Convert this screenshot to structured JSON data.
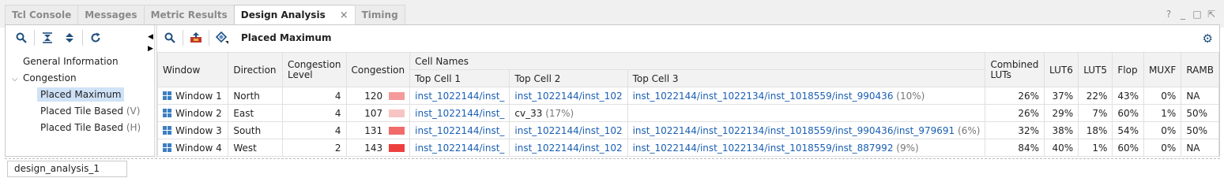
{
  "tabs": [
    {
      "label": "Tcl Console"
    },
    {
      "label": "Messages"
    },
    {
      "label": "Metric Results"
    },
    {
      "label": "Design Analysis",
      "close": "×"
    },
    {
      "label": "Timing"
    }
  ],
  "window_controls": {
    "help": "?",
    "minimize": "_",
    "restore": "□",
    "maximize": "⇱"
  },
  "left_tree": {
    "items": [
      {
        "label": "General Information",
        "sub": ""
      },
      {
        "label": "Congestion",
        "sub": ""
      },
      {
        "label": "Placed Maximum",
        "sub": ""
      },
      {
        "label": "Placed Tile Based",
        "sub": "(V)"
      },
      {
        "label": "Placed Tile Based",
        "sub": "(H)"
      }
    ]
  },
  "right_toolbar": {
    "title": "Placed Maximum"
  },
  "table": {
    "headers": {
      "window": "Window",
      "direction": "Direction",
      "congestion_level": "Congestion Level",
      "congestion": "Congestion",
      "cell_names": "Cell Names",
      "top_cell_1": "Top Cell 1",
      "top_cell_2": "Top Cell 2",
      "top_cell_3": "Top Cell 3",
      "combined_luts": "Combined LUTs",
      "lut6": "LUT6",
      "lut5": "LUT5",
      "flop": "Flop",
      "muxf": "MUXF",
      "ramb": "RAMB"
    },
    "rows": [
      {
        "window": "Window 1",
        "direction": "North",
        "level": "4",
        "congestion": "120",
        "color": "#f59a9a",
        "cell1": "inst_1022144/inst_",
        "cell2": "inst_1022144/inst_102",
        "cell2_pct": "",
        "cell3": "inst_1022144/inst_1022134/inst_1018559/inst_990436",
        "cell3_pct": "(10%)",
        "combined": "26%",
        "lut6": "37%",
        "lut5": "22%",
        "flop": "43%",
        "muxf": "0%",
        "ramb": "NA"
      },
      {
        "window": "Window 2",
        "direction": "East",
        "level": "4",
        "congestion": "107",
        "color": "#f7c4c4",
        "cell1": "inst_1022144/inst_",
        "cell2": "cv_33",
        "cell2_pct": "(17%)",
        "cell3": "",
        "cell3_pct": "",
        "combined": "26%",
        "lut6": "29%",
        "lut5": "7%",
        "flop": "60%",
        "muxf": "1%",
        "ramb": "50%"
      },
      {
        "window": "Window 3",
        "direction": "South",
        "level": "4",
        "congestion": "131",
        "color": "#f26a6a",
        "cell1": "inst_1022144/inst_",
        "cell2": "inst_1022144/inst_102",
        "cell2_pct": "",
        "cell3": "inst_1022144/inst_1022134/inst_1018559/inst_990436/inst_979691",
        "cell3_pct": "(6%)",
        "combined": "32%",
        "lut6": "38%",
        "lut5": "18%",
        "flop": "54%",
        "muxf": "0%",
        "ramb": "50%"
      },
      {
        "window": "Window 4",
        "direction": "West",
        "level": "2",
        "congestion": "143",
        "color": "#ee3f3f",
        "cell1": "inst_1022144/inst_",
        "cell2": "inst_1022144/inst_102",
        "cell2_pct": "",
        "cell3": "inst_1022144/inst_1022134/inst_1018559/inst_887992",
        "cell3_pct": "(9%)",
        "combined": "84%",
        "lut6": "40%",
        "lut5": "1%",
        "flop": "60%",
        "muxf": "0%",
        "ramb": "NA"
      }
    ]
  },
  "bottom_tab": {
    "label": "design_analysis_1"
  },
  "colors": {
    "accent": "#1a5fb4",
    "selected": "#cfe2f7"
  }
}
